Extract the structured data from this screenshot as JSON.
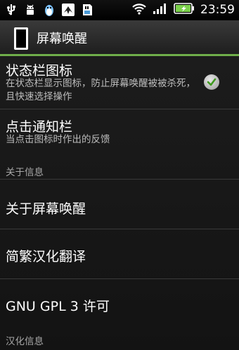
{
  "status_bar": {
    "icons_left": [
      "usb-icon",
      "android-debug-icon",
      "qq-penguin-icon",
      "bird-app-icon",
      "sd-card-icon"
    ],
    "icons_right": [
      "wifi-icon",
      "signal-icon",
      "battery-icon"
    ],
    "time": "23:59"
  },
  "header": {
    "title": "屏幕唤醒",
    "icon": "phone-outline-icon"
  },
  "preferences": [
    {
      "title": "状态栏图标",
      "summary": "在状态栏显示图标，防止屏幕唤醒被被杀死，且快速选择操作",
      "checked": true
    },
    {
      "title": "点击通知栏",
      "summary": "当点击图标时作出的反馈"
    }
  ],
  "sections": {
    "about": "关于信息",
    "about_items": [
      "关于屏幕唤醒",
      "简繁汉化翻译",
      "GNU GPL 3 许可"
    ],
    "localization": "汉化信息"
  },
  "colors": {
    "accent": "#6fae4a",
    "battery": "#7bd14b"
  }
}
